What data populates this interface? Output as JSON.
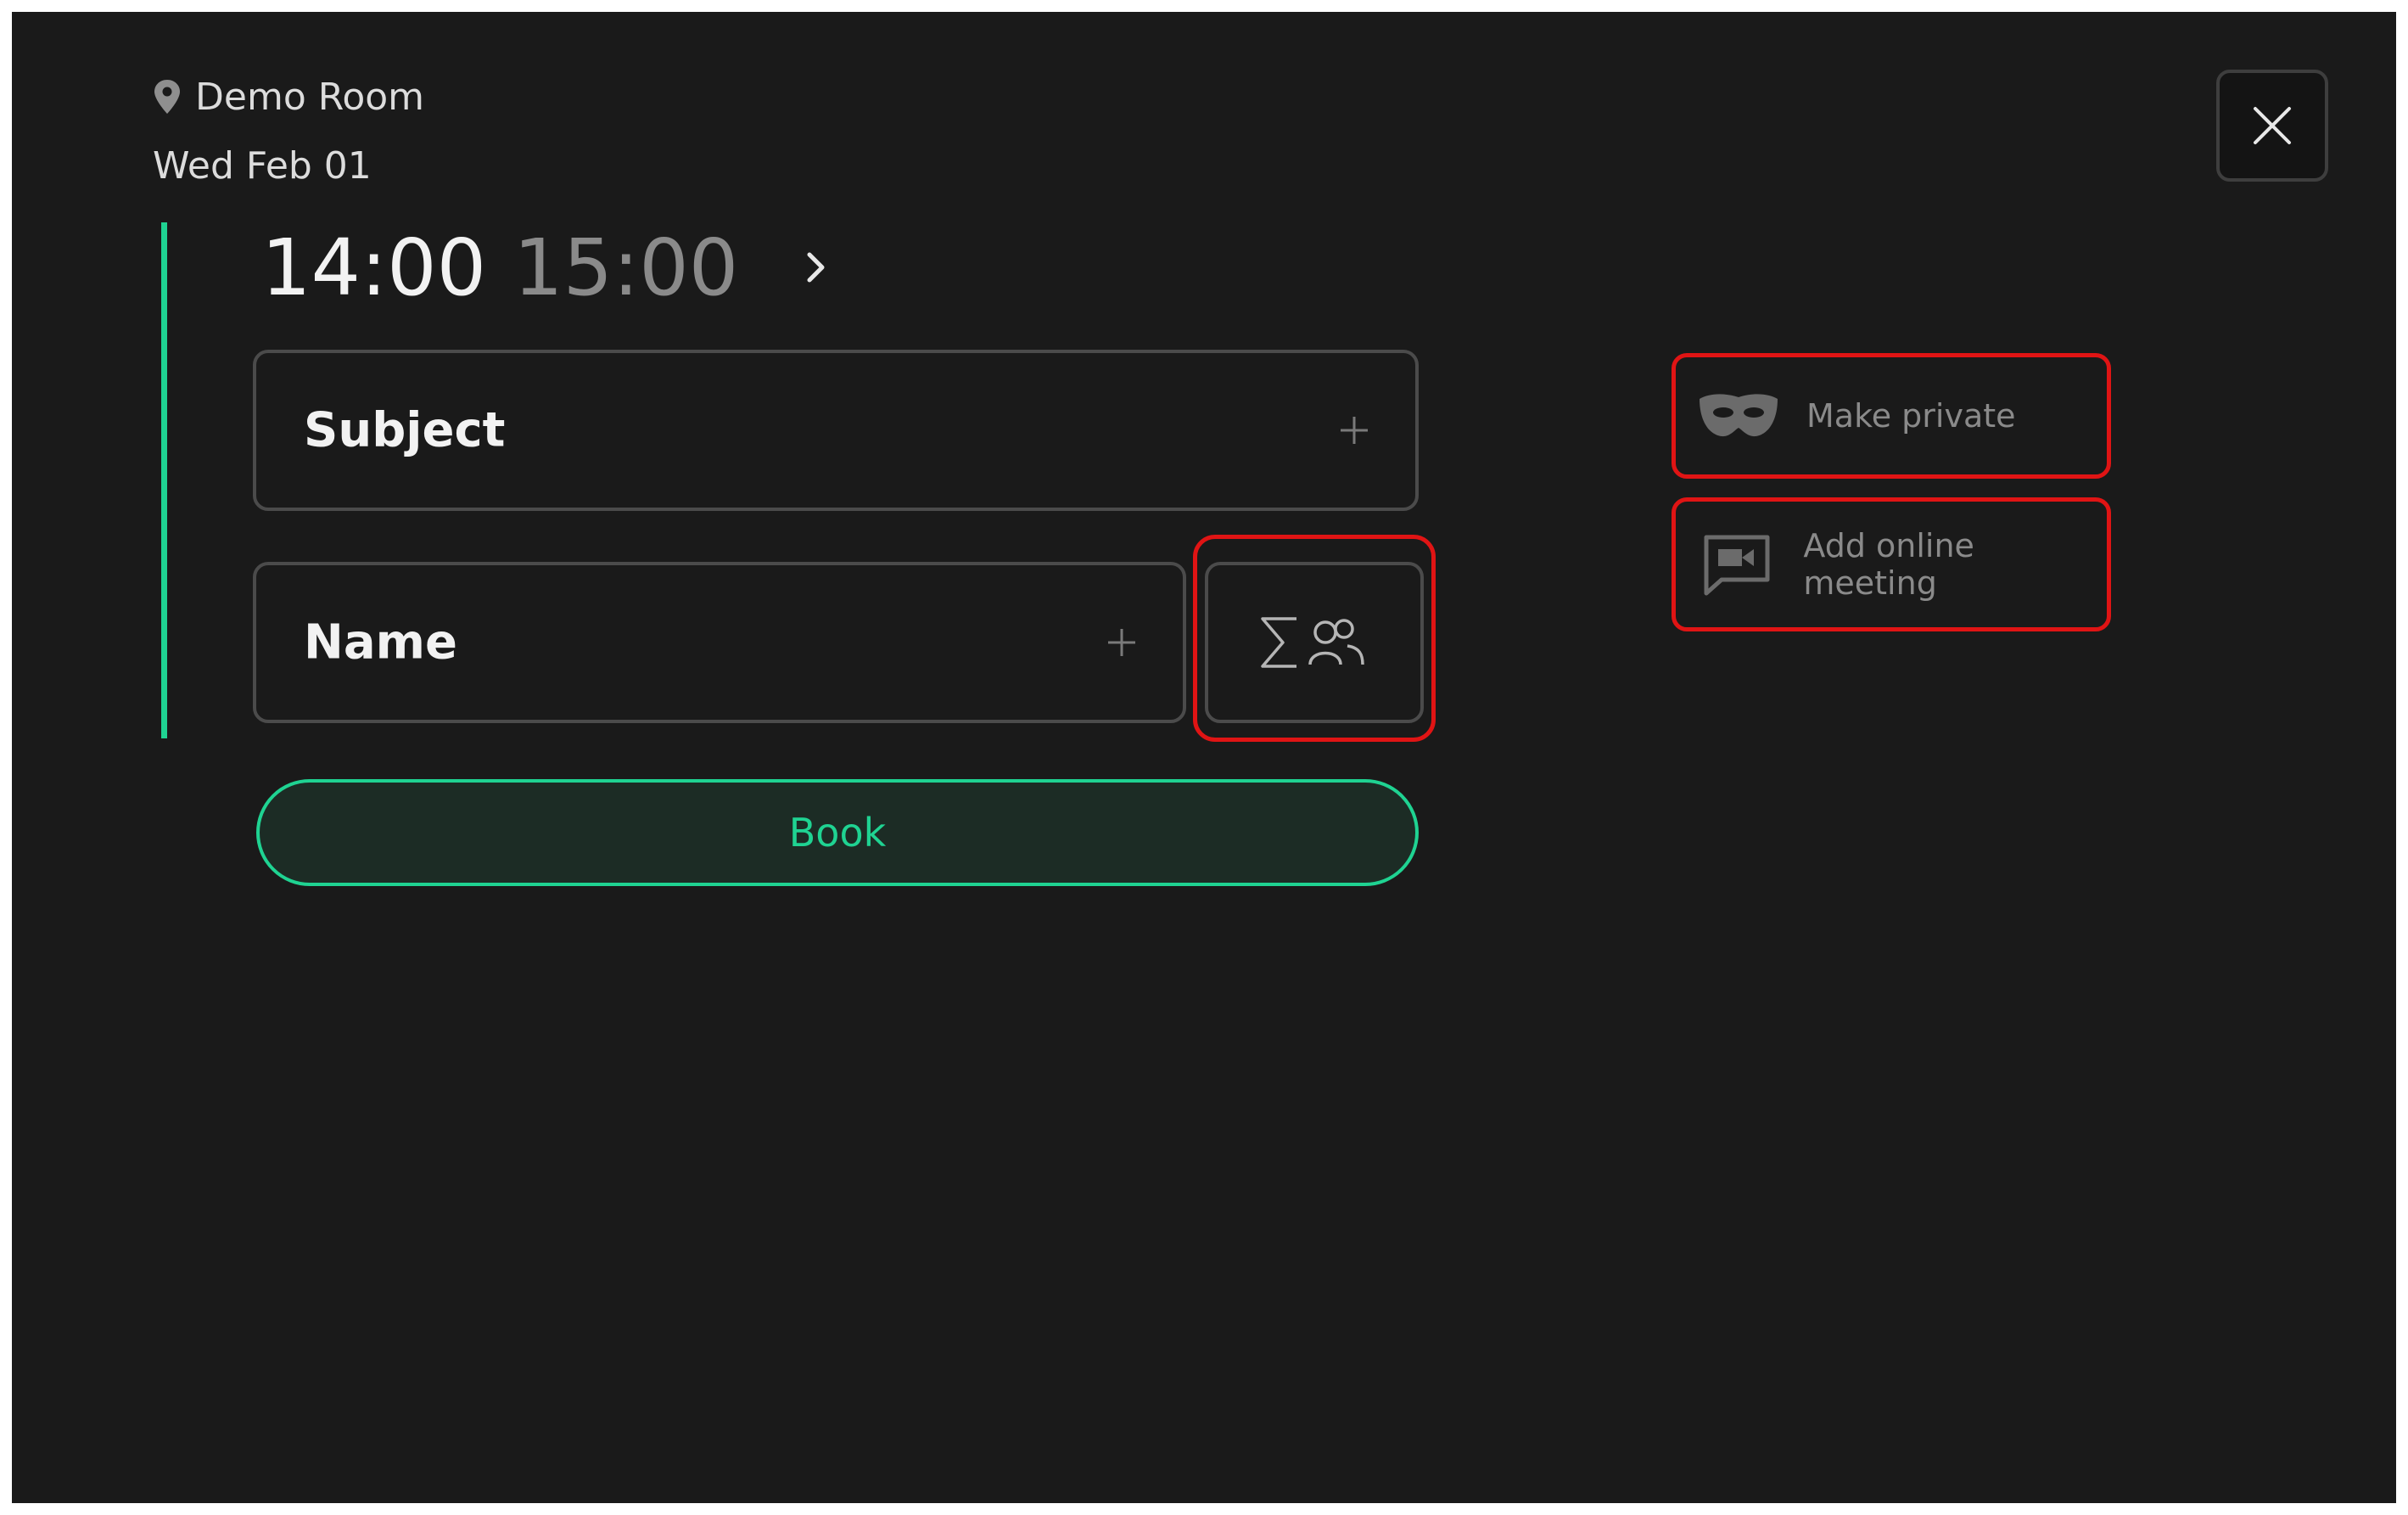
{
  "header": {
    "location": "Demo Room",
    "date": "Wed Feb 01"
  },
  "time": {
    "start": "14:00",
    "end": "15:00"
  },
  "form": {
    "subject_label": "Subject",
    "name_label": "Name",
    "book_label": "Book"
  },
  "options": {
    "make_private_label": "Make private",
    "online_meeting_label": "Add online meeting"
  },
  "colors": {
    "accent": "#1fd392",
    "background": "#1a1a1a",
    "highlight": "#e01414"
  },
  "icons": {
    "location": "location-pin-icon",
    "next": "chevron-right-icon",
    "plus": "plus-icon",
    "attendees": "sum-attendees-icon",
    "close": "close-icon",
    "private": "mask-icon",
    "online": "video-chat-icon"
  }
}
